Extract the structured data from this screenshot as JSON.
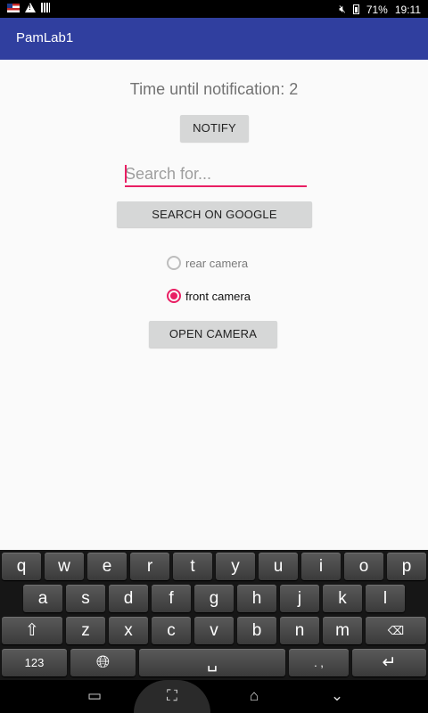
{
  "status_bar": {
    "battery": "71%",
    "time": "19:11",
    "icons": [
      "us-flag-icon",
      "warning-icon",
      "bars-icon",
      "mute-icon",
      "battery-icon"
    ]
  },
  "app_bar": {
    "title": "PamLab1",
    "color": "#303f9f"
  },
  "main": {
    "time_label": "Time until notification: 2",
    "notify_label": "NOTIFY",
    "search_placeholder": "Search for...",
    "search_value": "",
    "google_label": "SEARCH ON GOOGLE",
    "camera_options": [
      {
        "label": "rear camera",
        "checked": false
      },
      {
        "label": "front camera",
        "checked": true
      }
    ],
    "open_camera_label": "OPEN CAMERA",
    "accent": "#e91e63"
  },
  "keyboard": {
    "row1": [
      "q",
      "w",
      "e",
      "r",
      "t",
      "y",
      "u",
      "i",
      "o",
      "p"
    ],
    "row2": [
      "a",
      "s",
      "d",
      "f",
      "g",
      "h",
      "j",
      "k",
      "l"
    ],
    "row3": [
      "z",
      "x",
      "c",
      "v",
      "b",
      "n",
      "m"
    ],
    "numbers_label": "123",
    "punct_label": ". ,",
    "icons": [
      "shift-icon",
      "backspace-icon",
      "globe-icon",
      "space-icon",
      "enter-icon"
    ]
  },
  "nav_bar": {
    "icons": [
      "recent-apps-icon",
      "screenshot-icon",
      "home-icon",
      "back-icon"
    ]
  }
}
